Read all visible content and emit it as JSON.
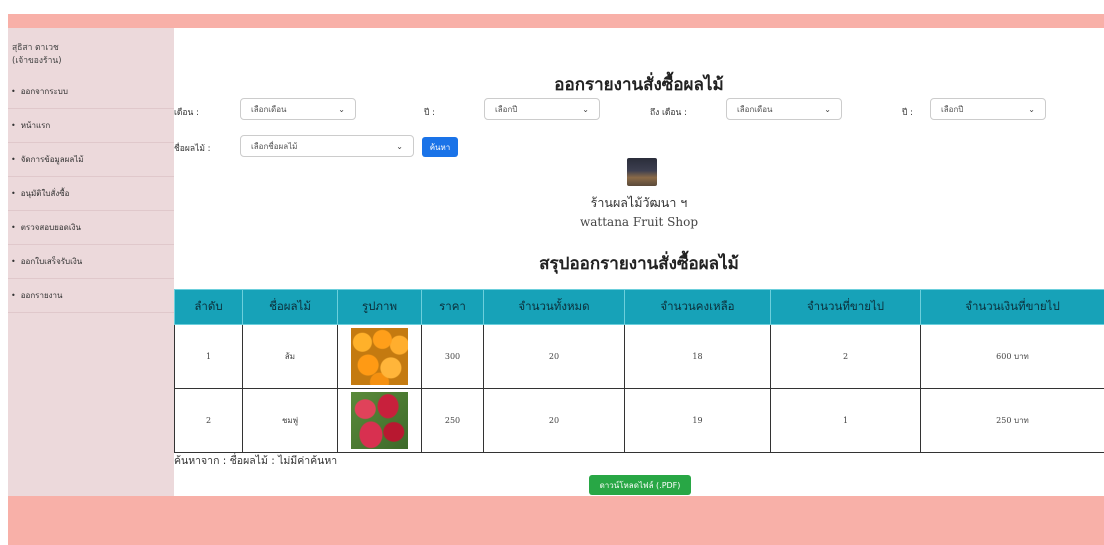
{
  "sidebar": {
    "user_name": "สุธิสา ตาเวช",
    "user_role": "(เจ้าของร้าน)",
    "items": [
      {
        "label": "ออกจากระบบ"
      },
      {
        "label": "หน้าแรก"
      },
      {
        "label": "จัดการข้อมูลผลไม้"
      },
      {
        "label": "อนุมัติใบสั่งซื้อ"
      },
      {
        "label": "ตรวจสอบยอดเงิน"
      },
      {
        "label": "ออกใบเสร็จรับเงิน"
      },
      {
        "label": "ออกรายงาน"
      }
    ]
  },
  "page": {
    "title": "ออกรายงานสั่งซื้อผลไม้"
  },
  "filters": {
    "month_label": "เดือน :",
    "month_value": "เลือกเดือน",
    "year_label": "ปี :",
    "year_value": "เลือกปี",
    "to_month_label": "ถึง เดือน :",
    "to_month_value": "เลือกเดือน",
    "to_year_label": "ปี :",
    "to_year_value": "เลือกปี",
    "fruit_label": "ชื่อผลไม้ :",
    "fruit_value": "เลือกชื่อผลไม้",
    "search_button": "ค้นหา"
  },
  "shop": {
    "logo_icon": "shop-logo-icon",
    "name_th": "ร้านผลไม้วัฒนา ฯ",
    "name_en": "wattana Fruit Shop"
  },
  "summary": {
    "title": "สรุปออกรายงานสั่งซื้อผลไม้"
  },
  "table": {
    "headers": [
      "ลำดับ",
      "ชื่อผลไม้",
      "รูปภาพ",
      "ราคา",
      "จำนวนทั้งหมด",
      "จำนวนคงเหลือ",
      "จำนวนที่ขายไป",
      "จำนวนเงินที่ขายไป"
    ],
    "rows": [
      {
        "no": "1",
        "name": "ส้ม",
        "image": "orange-image",
        "price": "300",
        "total": "20",
        "remaining": "18",
        "sold": "2",
        "amount": "600 บาท"
      },
      {
        "no": "2",
        "name": "ชมพู่",
        "image": "rose-apple-image",
        "price": "250",
        "total": "20",
        "remaining": "19",
        "sold": "1",
        "amount": "250 บาท"
      }
    ],
    "header_color": "#17a2b8"
  },
  "search_note": "ค้นหาจาก : ชื่อผลไม้ : ไม่มีค่าค้นหา",
  "download_button": "ดาวน์โหลดไฟล์ (.PDF)",
  "colors": {
    "accent_bar": "#f8b0a8",
    "sidebar_bg": "#ecd9db",
    "search_button": "#1a73e8",
    "download_button": "#28a745"
  }
}
